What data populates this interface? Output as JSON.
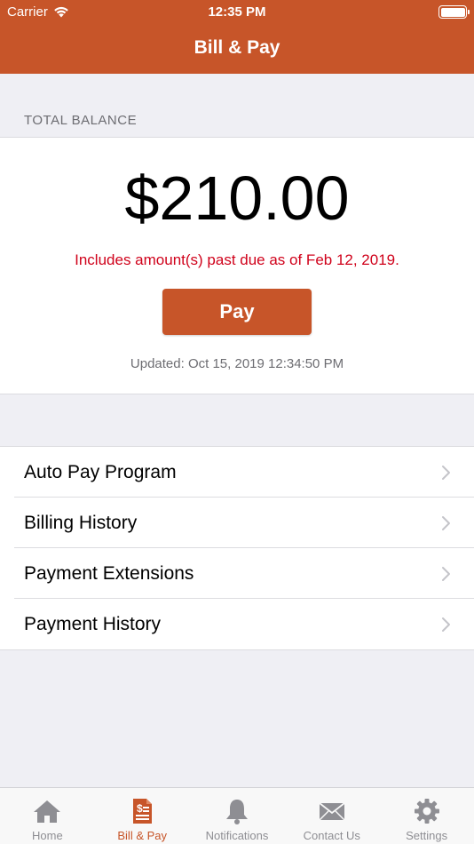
{
  "status_bar": {
    "carrier": "Carrier",
    "time": "12:35 PM"
  },
  "nav": {
    "title": "Bill & Pay"
  },
  "balance": {
    "section_label": "TOTAL BALANCE",
    "amount": "$210.00",
    "past_due_notice": "Includes amount(s) past due as of Feb 12, 2019.",
    "pay_label": "Pay",
    "updated": "Updated: Oct 15, 2019 12:34:50 PM"
  },
  "menu": {
    "items": [
      {
        "label": "Auto Pay Program"
      },
      {
        "label": "Billing History"
      },
      {
        "label": "Payment Extensions"
      },
      {
        "label": "Payment History"
      }
    ]
  },
  "tabs": [
    {
      "label": "Home",
      "icon": "home-icon"
    },
    {
      "label": "Bill & Pay",
      "icon": "bill-icon",
      "active": true
    },
    {
      "label": "Notifications",
      "icon": "bell-icon"
    },
    {
      "label": "Contact Us",
      "icon": "envelope-icon"
    },
    {
      "label": "Settings",
      "icon": "gear-icon"
    }
  ],
  "colors": {
    "brand": "#c75529",
    "past_due": "#d0021b",
    "tab_inactive": "#8e8e93"
  }
}
